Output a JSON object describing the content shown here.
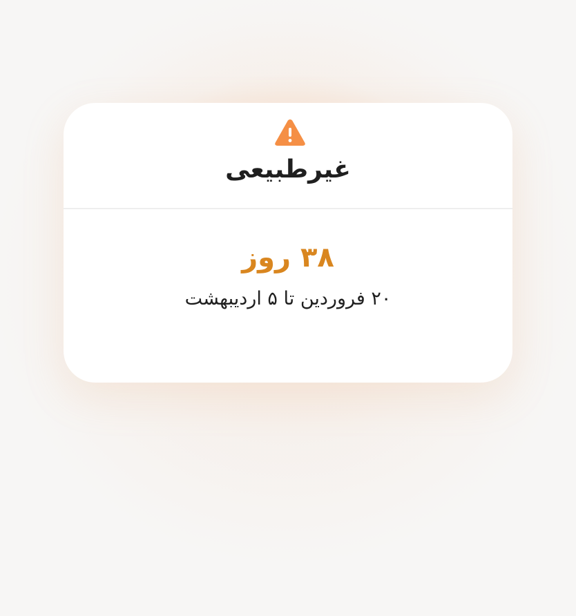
{
  "status": {
    "title": "غیرطبیعی",
    "icon": "warning-triangle-icon",
    "icon_color": "#f58f45"
  },
  "period": {
    "duration": "۳۸ روز",
    "date_range": "۲۰ فروردین تا ۵ اردیبهشت",
    "accent_color": "#d9861f"
  }
}
